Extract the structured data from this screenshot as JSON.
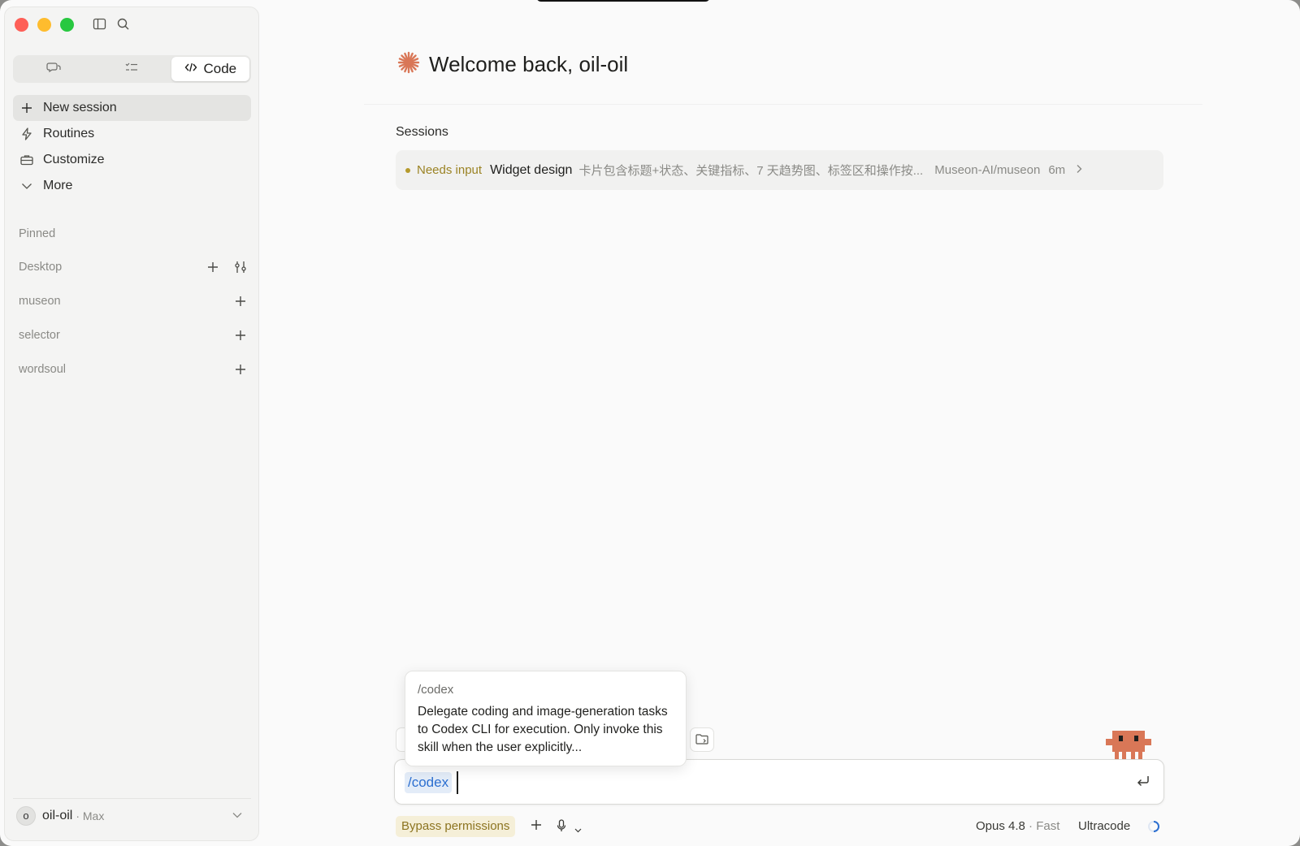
{
  "window": {
    "accent": "#d97757"
  },
  "sidebar": {
    "modes": [
      {
        "icon": "chat-icon",
        "label": ""
      },
      {
        "icon": "tasks-icon",
        "label": ""
      },
      {
        "icon": "code-icon",
        "label": "Code"
      }
    ],
    "nav": [
      {
        "icon": "plus-icon",
        "label": "New session"
      },
      {
        "icon": "lightning-icon",
        "label": "Routines"
      },
      {
        "icon": "briefcase-icon",
        "label": "Customize"
      },
      {
        "icon": "chevron-down-icon",
        "label": "More"
      }
    ],
    "pinned_label": "Pinned",
    "projects": [
      {
        "name": "Desktop"
      },
      {
        "name": "museon"
      },
      {
        "name": "selector"
      },
      {
        "name": "wordsoul"
      }
    ],
    "user": {
      "initial": "o",
      "name": "oil-oil",
      "plan": "· Max"
    }
  },
  "main": {
    "welcome": "Welcome back, oil-oil",
    "sessions_label": "Sessions",
    "sessions": [
      {
        "status": "Needs input",
        "status_color": "#b59a2c",
        "title": "Widget design",
        "description": "卡片包含标题+状态、关键指标、7 天趋势图、标签区和操作按...",
        "repo": "Museon-AI/museon",
        "time": "6m"
      }
    ]
  },
  "composer": {
    "value": "/codex",
    "popover": {
      "command": "/codex",
      "description": "Delegate coding and image-generation tasks to Codex CLI for execution. Only invoke this skill when the user explicitly..."
    },
    "permissions": "Bypass permissions",
    "model": "Opus 4.8",
    "speed": "· Fast",
    "mode": "Ultracode"
  }
}
